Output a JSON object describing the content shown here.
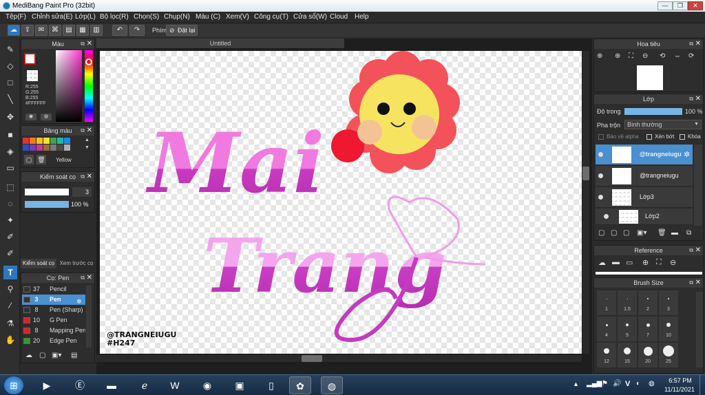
{
  "app": {
    "title": "MediBang Paint Pro (32bit)"
  },
  "window_controls": {
    "minimize": "—",
    "restore": "❐",
    "close": "✕"
  },
  "menu": [
    "Tệp(F)",
    "Chỉnh sửa(E)",
    "Lớp(L)",
    "Bộ lọc(R)",
    "Chọn(S)",
    "Chụp(N)",
    "Màu (C)",
    "Xem(V)",
    "Công cụ(T)",
    "Cửa sổ(W)",
    "Cloud",
    "Help"
  ],
  "toolbar": {
    "hotkey_label": "Phím",
    "reset_label": "Đặt lại"
  },
  "color_panel": {
    "title": "Màu",
    "rgb_r": "R:255",
    "rgb_g": "G:255",
    "rgb_b": "B:255",
    "hex": "#FFFFFF"
  },
  "palette_panel": {
    "title": "Bảng màu",
    "selected_name": "Yellow",
    "colors": [
      "#e8302a",
      "#f07a1c",
      "#f2c21e",
      "#f0e33a",
      "#3aa845",
      "#1fb7b4",
      "#1c8de0",
      "#2b4fc0",
      "#7a3bb8",
      "#c43a8c",
      "#9b6b3a",
      "#7a7a7a",
      "#4a4a4a",
      "#b0b0b0"
    ]
  },
  "brush_control": {
    "title": "Kiểm soát cọ",
    "size": "3",
    "opacity": "100 %"
  },
  "left_tabs": {
    "tab1": "Kiểm soát cọ",
    "tab2": "Xem trước cọ"
  },
  "brush_panel": {
    "title": "Cọ: Pen",
    "items": [
      {
        "num": "37",
        "name": "Pencil",
        "color": "#333333"
      },
      {
        "num": "3",
        "name": "Pen",
        "color": "#333333"
      },
      {
        "num": "8",
        "name": "Pen (Sharp)",
        "color": "#333333"
      },
      {
        "num": "10",
        "name": "G Pen",
        "color": "#e02020"
      },
      {
        "num": "8",
        "name": "Mapping Pen",
        "color": "#e02020"
      },
      {
        "num": "20",
        "name": "Edge Pen",
        "color": "#28a028"
      }
    ]
  },
  "canvas": {
    "tab_title": "Untitled",
    "text_main_1": "Mai",
    "text_main_2": "Trang",
    "signature_1": "@TRANGNEIUGU",
    "signature_2": "#H247"
  },
  "navigator": {
    "title": "Hoa tiêu"
  },
  "layers_panel": {
    "title": "Lớp",
    "opacity_label": "Độ trong",
    "opacity_value": "100 %",
    "blend_label": "Pha trộn",
    "blend_value": "Bình thường",
    "protect_alpha": "Bảo vệ alpha",
    "clipping": "Xén bớt",
    "lock": "Khóa",
    "layers": [
      {
        "name": "@trangneiugu"
      },
      {
        "name": "@trangneiugu"
      },
      {
        "name": "Lớp3"
      },
      {
        "name": "Lớp2"
      }
    ]
  },
  "reference_panel": {
    "title": "Reference"
  },
  "brush_size_panel": {
    "title": "Brush Size",
    "sizes": [
      "1",
      "1.5",
      "2",
      "3",
      "4",
      "5",
      "7",
      "10",
      "12",
      "15",
      "20",
      "25"
    ]
  },
  "taskbar": {
    "time": "6:57 PM",
    "date": "11/11/2021",
    "lang": "V"
  }
}
